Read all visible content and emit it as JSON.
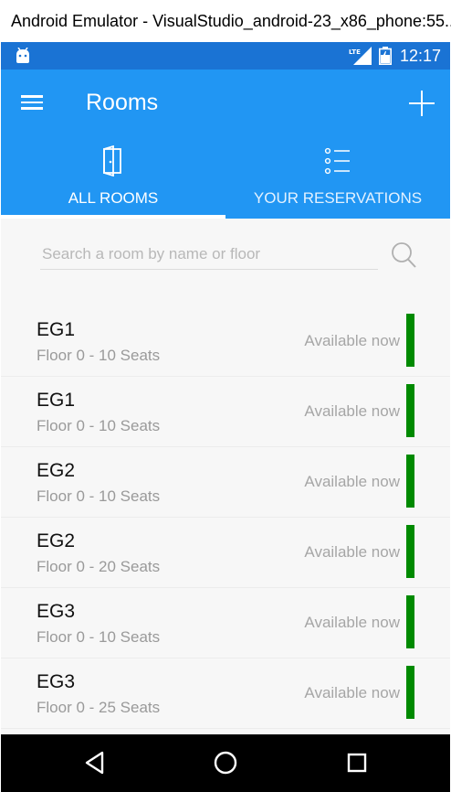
{
  "window": {
    "title": "Android Emulator - VisualStudio_android-23_x86_phone:55..."
  },
  "status_bar": {
    "network": "LTE",
    "time": "12:17"
  },
  "app_bar": {
    "title": "Rooms"
  },
  "tabs": [
    {
      "label": "ALL ROOMS",
      "icon": "door-icon",
      "selected": true
    },
    {
      "label": "YOUR RESERVATIONS",
      "icon": "list-icon",
      "selected": false
    }
  ],
  "search": {
    "placeholder": "Search a room by name or floor",
    "value": ""
  },
  "rooms": [
    {
      "name": "EG1",
      "detail": "Floor 0 - 10 Seats",
      "status": "Available now"
    },
    {
      "name": "EG1",
      "detail": "Floor 0 - 10 Seats",
      "status": "Available now"
    },
    {
      "name": "EG2",
      "detail": "Floor 0 - 10 Seats",
      "status": "Available now"
    },
    {
      "name": "EG2",
      "detail": "Floor 0 - 20 Seats",
      "status": "Available now"
    },
    {
      "name": "EG3",
      "detail": "Floor 0 - 10 Seats",
      "status": "Available now"
    },
    {
      "name": "EG3",
      "detail": "Floor 0 - 25 Seats",
      "status": "Available now"
    }
  ],
  "colors": {
    "status_bar": "#1a73d4",
    "app_bar": "#2196f3",
    "available": "#008a00",
    "nav_bar": "#000000"
  }
}
